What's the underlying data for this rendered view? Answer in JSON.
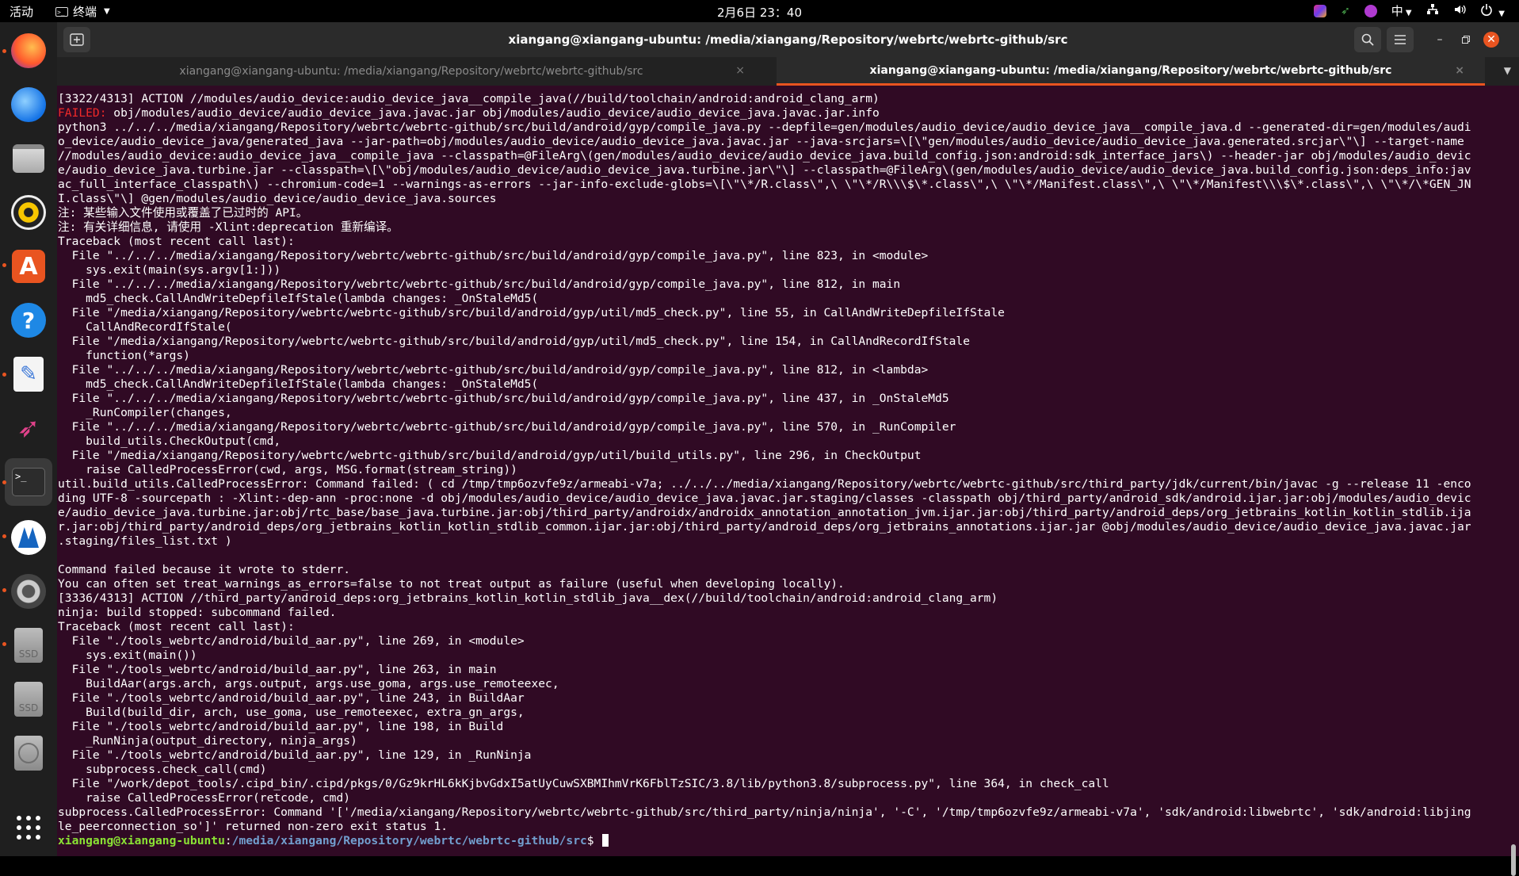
{
  "topbar": {
    "activities": "活动",
    "app_menu": "终端",
    "clock": "2月6日 23：40",
    "input_method": "中"
  },
  "window": {
    "title": "xiangang@xiangang-ubuntu: /media/xiangang/Repository/webrtc/webrtc-github/src",
    "tabs": [
      {
        "label": "xiangang@xiangang-ubuntu: /media/xiangang/Repository/webrtc/webrtc-github/src",
        "active": false
      },
      {
        "label": "xiangang@xiangang-ubuntu: /media/xiangang/Repository/webrtc/webrtc-github/src",
        "active": true
      }
    ],
    "tab_close": "×"
  },
  "dock": {
    "apps": [
      "firefox-icon",
      "thunderbird-icon",
      "files-icon",
      "rhythmbox-icon",
      "software-icon",
      "help-icon",
      "text-editor-icon",
      "kali-icon",
      "terminal-icon",
      "app-icon",
      "settings-icon",
      "ssd-drive-icon",
      "ssd-drive-icon",
      "disc-icon",
      "show-apps-icon"
    ],
    "ssd_label": "SSD"
  },
  "terminal": {
    "lines": [
      "[3322/4313] ACTION //modules/audio_device:audio_device_java__compile_java(//build/toolchain/android:android_clang_arm)",
      " obj/modules/audio_device/audio_device_java.javac.jar obj/modules/audio_device/audio_device_java.javac.jar.info",
      "python3 ../../../media/xiangang/Repository/webrtc/webrtc-github/src/build/android/gyp/compile_java.py --depfile=gen/modules/audio_device/audio_device_java__compile_java.d --generated-dir=gen/modules/audi",
      "o_device/audio_device_java/generated_java --jar-path=obj/modules/audio_device/audio_device_java.javac.jar --java-srcjars=\\[\\\"gen/modules/audio_device/audio_device_java.generated.srcjar\\\"\\] --target-name",
      "//modules/audio_device:audio_device_java__compile_java --classpath=@FileArg\\(gen/modules/audio_device/audio_device_java.build_config.json:android:sdk_interface_jars\\) --header-jar obj/modules/audio_devic",
      "e/audio_device_java.turbine.jar --classpath=\\[\\\"obj/modules/audio_device/audio_device_java.turbine.jar\\\"\\] --classpath=@FileArg\\(gen/modules/audio_device/audio_device_java.build_config.json:deps_info:jav",
      "ac_full_interface_classpath\\) --chromium-code=1 --warnings-as-errors --jar-info-exclude-globs=\\[\\\"\\*/R.class\\\",\\ \\\"\\*/R\\\\\\$\\*.class\\\",\\ \\\"\\*/Manifest.class\\\",\\ \\\"\\*/Manifest\\\\\\$\\*.class\\\",\\ \\\"\\*/\\*GEN_JN",
      "I.class\\\"\\] @gen/modules/audio_device/audio_device_java.sources",
      "注: 某些输入文件使用或覆盖了已过时的 API。",
      "注: 有关详细信息, 请使用 -Xlint:deprecation 重新编译。",
      "Traceback (most recent call last):",
      "  File \"../../../media/xiangang/Repository/webrtc/webrtc-github/src/build/android/gyp/compile_java.py\", line 823, in <module>",
      "    sys.exit(main(sys.argv[1:]))",
      "  File \"../../../media/xiangang/Repository/webrtc/webrtc-github/src/build/android/gyp/compile_java.py\", line 812, in main",
      "    md5_check.CallAndWriteDepfileIfStale(lambda changes: _OnStaleMd5(",
      "  File \"/media/xiangang/Repository/webrtc/webrtc-github/src/build/android/gyp/util/md5_check.py\", line 55, in CallAndWriteDepfileIfStale",
      "    CallAndRecordIfStale(",
      "  File \"/media/xiangang/Repository/webrtc/webrtc-github/src/build/android/gyp/util/md5_check.py\", line 154, in CallAndRecordIfStale",
      "    function(*args)",
      "  File \"../../../media/xiangang/Repository/webrtc/webrtc-github/src/build/android/gyp/compile_java.py\", line 812, in <lambda>",
      "    md5_check.CallAndWriteDepfileIfStale(lambda changes: _OnStaleMd5(",
      "  File \"../../../media/xiangang/Repository/webrtc/webrtc-github/src/build/android/gyp/compile_java.py\", line 437, in _OnStaleMd5",
      "    _RunCompiler(changes,",
      "  File \"../../../media/xiangang/Repository/webrtc/webrtc-github/src/build/android/gyp/compile_java.py\", line 570, in _RunCompiler",
      "    build_utils.CheckOutput(cmd,",
      "  File \"/media/xiangang/Repository/webrtc/webrtc-github/src/build/android/gyp/util/build_utils.py\", line 296, in CheckOutput",
      "    raise CalledProcessError(cwd, args, MSG.format(stream_string))",
      "util.build_utils.CalledProcessError: Command failed: ( cd /tmp/tmp6ozvfe9z/armeabi-v7a; ../../../media/xiangang/Repository/webrtc/webrtc-github/src/third_party/jdk/current/bin/javac -g --release 11 -enco",
      "ding UTF-8 -sourcepath : -Xlint:-dep-ann -proc:none -d obj/modules/audio_device/audio_device_java.javac.jar.staging/classes -classpath obj/third_party/android_sdk/android.ijar.jar:obj/modules/audio_devic",
      "e/audio_device_java.turbine.jar:obj/rtc_base/base_java.turbine.jar:obj/third_party/androidx/androidx_annotation_annotation_jvm.ijar.jar:obj/third_party/android_deps/org_jetbrains_kotlin_kotlin_stdlib.ija",
      "r.jar:obj/third_party/android_deps/org_jetbrains_kotlin_kotlin_stdlib_common.ijar.jar:obj/third_party/android_deps/org_jetbrains_annotations.ijar.jar @obj/modules/audio_device/audio_device_java.javac.jar",
      ".staging/files_list.txt )",
      "",
      "Command failed because it wrote to stderr.",
      "You can often set treat_warnings_as_errors=false to not treat output as failure (useful when developing locally).",
      "[3336/4313] ACTION //third_party/android_deps:org_jetbrains_kotlin_kotlin_stdlib_java__dex(//build/toolchain/android:android_clang_arm)",
      "ninja: build stopped: subcommand failed.",
      "Traceback (most recent call last):",
      "  File \"./tools_webrtc/android/build_aar.py\", line 269, in <module>",
      "    sys.exit(main())",
      "  File \"./tools_webrtc/android/build_aar.py\", line 263, in main",
      "    BuildAar(args.arch, args.output, args.use_goma, args.use_remoteexec,",
      "  File \"./tools_webrtc/android/build_aar.py\", line 243, in BuildAar",
      "    Build(build_dir, arch, use_goma, use_remoteexec, extra_gn_args,",
      "  File \"./tools_webrtc/android/build_aar.py\", line 198, in Build",
      "    _RunNinja(output_directory, ninja_args)",
      "  File \"./tools_webrtc/android/build_aar.py\", line 129, in _RunNinja",
      "    subprocess.check_call(cmd)",
      "  File \"/work/depot_tools/.cipd_bin/.cipd/pkgs/0/Gz9krHL6kKjbvGdxI5atUyCuwSXBMIhmVrK6FblTzSIC/3.8/lib/python3.8/subprocess.py\", line 364, in check_call",
      "    raise CalledProcessError(retcode, cmd)",
      "subprocess.CalledProcessError: Command '['/media/xiangang/Repository/webrtc/webrtc-github/src/third_party/ninja/ninja', '-C', '/tmp/tmp6ozvfe9z/armeabi-v7a', 'sdk/android:libwebrtc', 'sdk/android:libjing",
      "le_peerconnection_so']' returned non-zero exit status 1."
    ],
    "failed_label": "FAILED:",
    "prompt_user": "xiangang@xiangang-ubuntu",
    "prompt_sep": ":",
    "prompt_path": "/media/xiangang/Repository/webrtc/webrtc-github/src",
    "prompt_symbol": "$ "
  },
  "colors": {
    "terminal_bg": "#300a24",
    "accent": "#e95420",
    "prompt_user": "#8ae234",
    "prompt_path": "#729fcf",
    "failed": "#ef2929"
  }
}
